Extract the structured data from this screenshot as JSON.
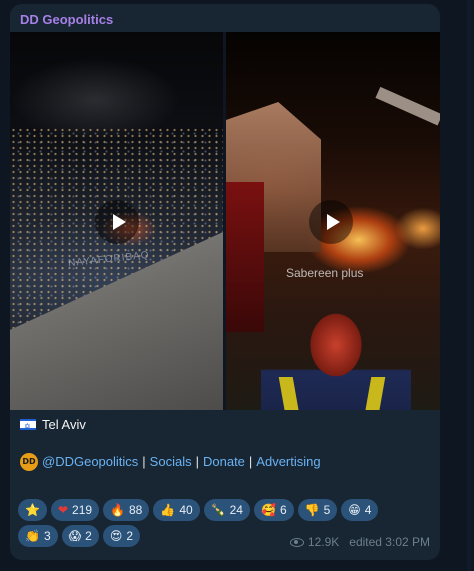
{
  "channel": {
    "name": "DD Geopolitics"
  },
  "media": {
    "left_watermark": "NAYAFORIBAQ",
    "right_watermark": "Sabereen plus"
  },
  "caption": {
    "flag_icon": "israel-flag-icon",
    "text": "Tel Aviv"
  },
  "links": {
    "handle": "@DDGeopolitics",
    "socials": "Socials",
    "donate": "Donate",
    "advertising": "Advertising",
    "separator": "|"
  },
  "reactions": [
    {
      "emoji": "⭐",
      "count": "",
      "icon": "star-icon"
    },
    {
      "emoji": "❤",
      "count": "219",
      "icon": "heart-icon"
    },
    {
      "emoji": "🔥",
      "count": "88",
      "icon": "fire-icon"
    },
    {
      "emoji": "👍",
      "count": "40",
      "icon": "thumbs-up-icon"
    },
    {
      "emoji": "🍾",
      "count": "24",
      "icon": "champagne-icon"
    },
    {
      "emoji": "🥰",
      "count": "6",
      "icon": "smiling-hearts-icon"
    },
    {
      "emoji": "👎",
      "count": "5",
      "icon": "thumbs-down-icon"
    },
    {
      "emoji": "😁",
      "count": "4",
      "icon": "grin-icon"
    },
    {
      "emoji": "👏",
      "count": "3",
      "icon": "clap-icon"
    },
    {
      "emoji": "😱",
      "count": "2",
      "icon": "scream-icon"
    },
    {
      "emoji": "😍",
      "count": "2",
      "icon": "heart-eyes-icon"
    }
  ],
  "meta": {
    "views": "12.9K",
    "edited": "edited 3:02 PM"
  }
}
